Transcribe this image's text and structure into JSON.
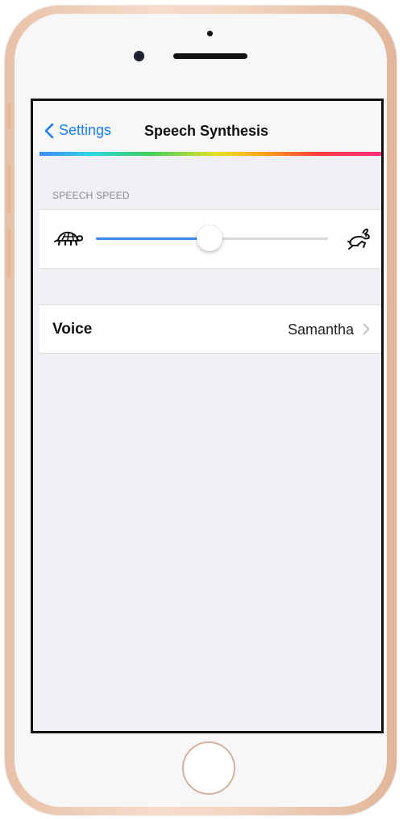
{
  "navbar": {
    "back_label": "Settings",
    "title": "Speech Synthesis"
  },
  "speech_speed": {
    "header": "SPEECH SPEED",
    "slider_value_fraction": 0.49,
    "min_icon": "turtle-icon",
    "max_icon": "rabbit-icon"
  },
  "voice": {
    "label": "Voice",
    "value": "Samantha"
  },
  "colors": {
    "accent": "#2F8CF1",
    "background": "#EFEFF4",
    "phone_frame": "#F3D4C0"
  }
}
